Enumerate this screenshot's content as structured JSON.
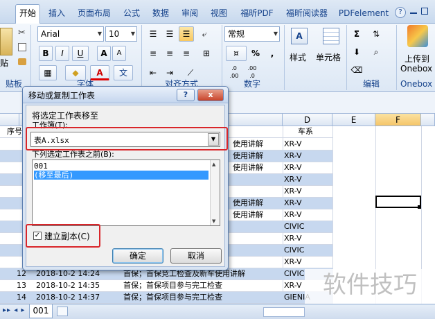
{
  "ribbon_tabs": [
    {
      "label": "开始",
      "active": true
    },
    {
      "label": "插入"
    },
    {
      "label": "页面布局"
    },
    {
      "label": "公式"
    },
    {
      "label": "数据"
    },
    {
      "label": "审阅"
    },
    {
      "label": "视图"
    },
    {
      "label": "福昕PDF"
    },
    {
      "label": "福昕阅读器"
    },
    {
      "label": "PDFelement"
    }
  ],
  "ribbon": {
    "paste_label": "贴",
    "clipboard_label": "贴板",
    "font_name": "Arial",
    "font_size": "10",
    "font_group_label": "字体",
    "bold": "B",
    "italic": "I",
    "underline": "U",
    "grow_font": "A",
    "shrink_font": "A",
    "color_a": "A",
    "phonetic": "文",
    "align_group_label": "对齐方式",
    "number_format": "常规",
    "percent": "%",
    "comma": ",",
    "inc_decimal": ".0\n.00",
    "dec_decimal": ".00\n.0",
    "number_group_label": "数字",
    "style_label": "样式",
    "cell_label": "单元格",
    "editing_group_label": "编辑",
    "sum": "Σ",
    "onedrive_label_1": "上传到",
    "onedrive_label_2": "Onebox",
    "onebox_group_label": "Onebox"
  },
  "sheet": {
    "columns": [
      "A",
      "D",
      "E",
      "F"
    ],
    "header_row": {
      "a": "序号",
      "d": "车系"
    },
    "rows": [
      {
        "alt": false,
        "num": "",
        "date": "",
        "desc": "使用讲解",
        "model": "XR-V"
      },
      {
        "alt": true,
        "num": "",
        "date": "",
        "desc": "使用讲解",
        "model": "XR-V"
      },
      {
        "alt": false,
        "num": "",
        "date": "",
        "desc": "使用讲解",
        "model": "XR-V"
      },
      {
        "alt": true,
        "num": "",
        "date": "",
        "desc": "",
        "model": "XR-V"
      },
      {
        "alt": false,
        "num": "",
        "date": "",
        "desc": "",
        "model": "XR-V"
      },
      {
        "alt": true,
        "num": "",
        "date": "",
        "desc": "使用讲解",
        "model": "XR-V"
      },
      {
        "alt": false,
        "num": "",
        "date": "",
        "desc": "使用讲解",
        "model": "XR-V"
      },
      {
        "alt": true,
        "num": "",
        "date": "",
        "desc": "",
        "model": "CIVIC"
      },
      {
        "alt": false,
        "num": "",
        "date": "",
        "desc": "",
        "model": "XR-V"
      },
      {
        "alt": true,
        "num": "",
        "date": "",
        "desc": "",
        "model": "CIVIC"
      },
      {
        "alt": false,
        "num": "",
        "date": "",
        "desc": "",
        "model": "XR-V"
      },
      {
        "alt": true,
        "num": "12",
        "date": "2018-10-2 14:24",
        "desc": "首保；首保竞工检查及新车使用讲解",
        "model": "CIVIC"
      },
      {
        "alt": false,
        "num": "13",
        "date": "2018-10-2 14:35",
        "desc": "首保；首保项目参与完工检查",
        "model": "XR-V"
      },
      {
        "alt": true,
        "num": "14",
        "date": "2018-10-2 14:37",
        "desc": "首保；首保项目参与完工检查",
        "model": "GIENIA"
      }
    ],
    "sheet_tab": "001"
  },
  "dialog": {
    "title": "移动或复制工作表",
    "help_button": "?",
    "close_button": "x",
    "move_label": "将选定工作表移至",
    "workbook_label": "工作簿(T):",
    "workbook_value": "表A.xlsx",
    "before_label": "下列选定工作表之前(B):",
    "list_items": [
      {
        "label": "001",
        "selected": false
      },
      {
        "label": "(移至最后)",
        "selected": true
      }
    ],
    "copy_checkbox_label": "建立副本(C)",
    "copy_checked": true,
    "ok_button": "确定",
    "cancel_button": "取消"
  },
  "watermark": "软件技巧"
}
